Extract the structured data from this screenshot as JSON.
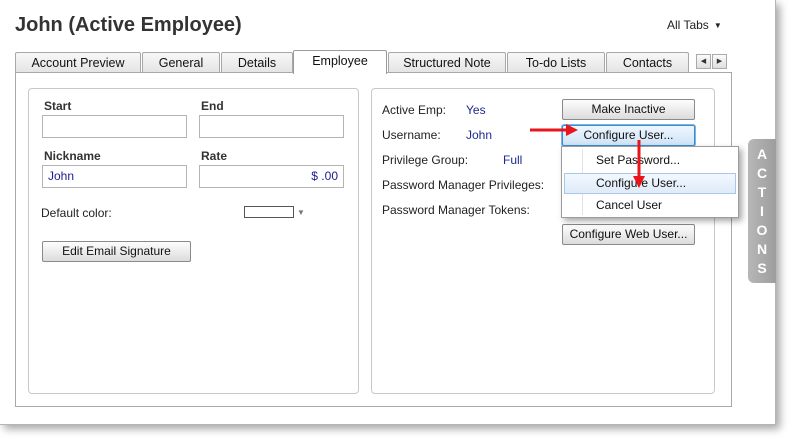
{
  "header": {
    "title": "John  (Active Employee)",
    "all_tabs": "All Tabs"
  },
  "tabs": [
    {
      "label": "Account Preview"
    },
    {
      "label": "General"
    },
    {
      "label": "Details"
    },
    {
      "label": "Employee",
      "active": true
    },
    {
      "label": "Structured Note"
    },
    {
      "label": "To-do Lists"
    },
    {
      "label": "Contacts"
    }
  ],
  "left_panel": {
    "start_label": "Start",
    "start_value": "",
    "end_label": "End",
    "end_value": "",
    "nickname_label": "Nickname",
    "nickname_value": "John",
    "rate_label": "Rate",
    "rate_value": "$ .00",
    "default_color_label": "Default color:",
    "default_color_value": "#ffffff",
    "edit_signature_button": "Edit Email Signature"
  },
  "right_panel": {
    "active_emp_label": "Active Emp:",
    "active_emp_value": "Yes",
    "username_label": "Username:",
    "username_value": "John",
    "privilege_group_label": "Privilege Group:",
    "privilege_group_value": "Full",
    "pm_privileges_label": "Password Manager Privileges:",
    "pm_tokens_label": "Password Manager Tokens:",
    "make_inactive_button": "Make Inactive",
    "configure_user_button": "Configure User...",
    "configure_web_user_button": "Configure Web User..."
  },
  "dropdown_menu": {
    "items": [
      {
        "label": "Set Password..."
      },
      {
        "label": "Configure User...",
        "highlighted": true
      },
      {
        "label": "Cancel User"
      }
    ]
  },
  "actions_panel": {
    "letters": [
      "A",
      "C",
      "T",
      "I",
      "O",
      "N",
      "S"
    ]
  },
  "colors": {
    "annotation_arrow": "#e8151b",
    "value_text": "#1c2a8c",
    "focus_border": "#3a8dd0"
  }
}
